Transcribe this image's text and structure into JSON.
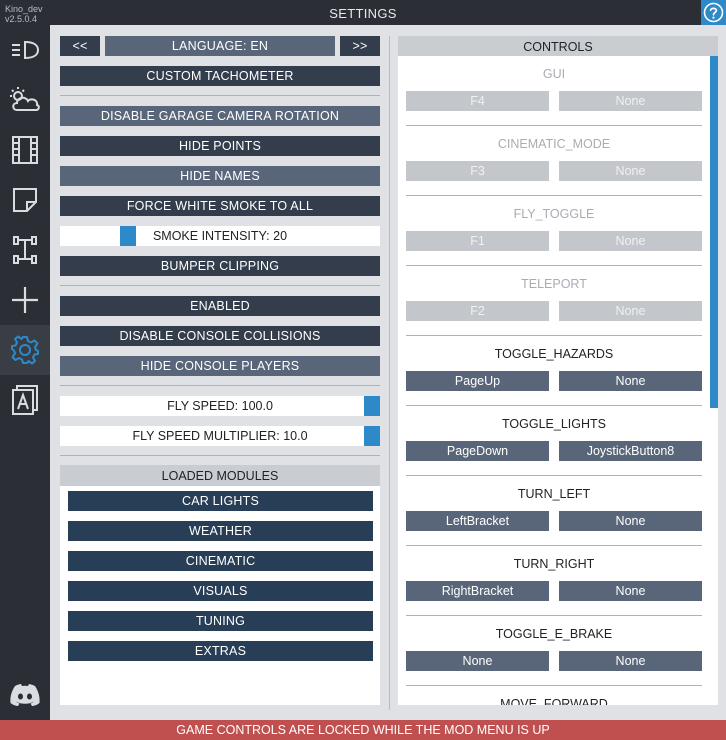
{
  "app": {
    "name": "Kino_dev",
    "version": "v2.5.0.4",
    "title": "SETTINGS"
  },
  "colors": {
    "accent": "#2e89c9",
    "footer": "#c0504f",
    "button_dark": "#343d4b",
    "button_light": "#596679",
    "module": "#283e57"
  },
  "sidebar": {
    "items": [
      {
        "icon": "headlight-icon"
      },
      {
        "icon": "weather-icon"
      },
      {
        "icon": "film-icon"
      },
      {
        "icon": "sticker-icon"
      },
      {
        "icon": "tuning-icon"
      },
      {
        "icon": "plus-icon"
      },
      {
        "icon": "gear-icon",
        "active": true
      },
      {
        "icon": "font-icon"
      },
      {
        "icon": "discord-icon"
      }
    ]
  },
  "settings": {
    "lang_prev": "<<",
    "language": "LANGUAGE: EN",
    "lang_next": ">>",
    "custom_tachometer": "CUSTOM TACHOMETER",
    "disable_garage_rotation": "DISABLE GARAGE CAMERA ROTATION",
    "hide_points": "HIDE POINTS",
    "hide_names": "HIDE NAMES",
    "force_white_smoke": "FORCE WHITE SMOKE TO ALL",
    "smoke_intensity": "SMOKE INTENSITY: 20",
    "smoke_intensity_value": 20,
    "bumper_clipping": "BUMPER CLIPPING",
    "enabled": "ENABLED",
    "disable_console_collisions": "DISABLE CONSOLE COLLISIONS",
    "hide_console_players": "HIDE CONSOLE PLAYERS",
    "fly_speed": "FLY SPEED: 100.0",
    "fly_speed_value": 100.0,
    "fly_speed_multiplier": "FLY SPEED MULTIPLIER: 10.0",
    "fly_speed_multiplier_value": 10.0
  },
  "modules": {
    "title": "LOADED MODULES",
    "items": [
      "CAR LIGHTS",
      "WEATHER",
      "CINEMATIC",
      "VISUALS",
      "TUNING",
      "EXTRAS"
    ]
  },
  "controls": {
    "title": "CONTROLS",
    "items": [
      {
        "name": "GUI",
        "primary": "F4",
        "secondary": "None",
        "enabled": false
      },
      {
        "name": "CINEMATIC_MODE",
        "primary": "F3",
        "secondary": "None",
        "enabled": false
      },
      {
        "name": "FLY_TOGGLE",
        "primary": "F1",
        "secondary": "None",
        "enabled": false
      },
      {
        "name": "TELEPORT",
        "primary": "F2",
        "secondary": "None",
        "enabled": false
      },
      {
        "name": "TOGGLE_HAZARDS",
        "primary": "PageUp",
        "secondary": "None",
        "enabled": true
      },
      {
        "name": "TOGGLE_LIGHTS",
        "primary": "PageDown",
        "secondary": "JoystickButton8",
        "enabled": true
      },
      {
        "name": "TURN_LEFT",
        "primary": "LeftBracket",
        "secondary": "None",
        "enabled": true
      },
      {
        "name": "TURN_RIGHT",
        "primary": "RightBracket",
        "secondary": "None",
        "enabled": true
      },
      {
        "name": "TOGGLE_E_BRAKE",
        "primary": "None",
        "secondary": "None",
        "enabled": true
      },
      {
        "name": "MOVE_FORWARD",
        "primary": "",
        "secondary": "",
        "enabled": true
      }
    ]
  },
  "footer": {
    "message": "GAME CONTROLS ARE LOCKED WHILE THE MOD MENU IS UP"
  }
}
